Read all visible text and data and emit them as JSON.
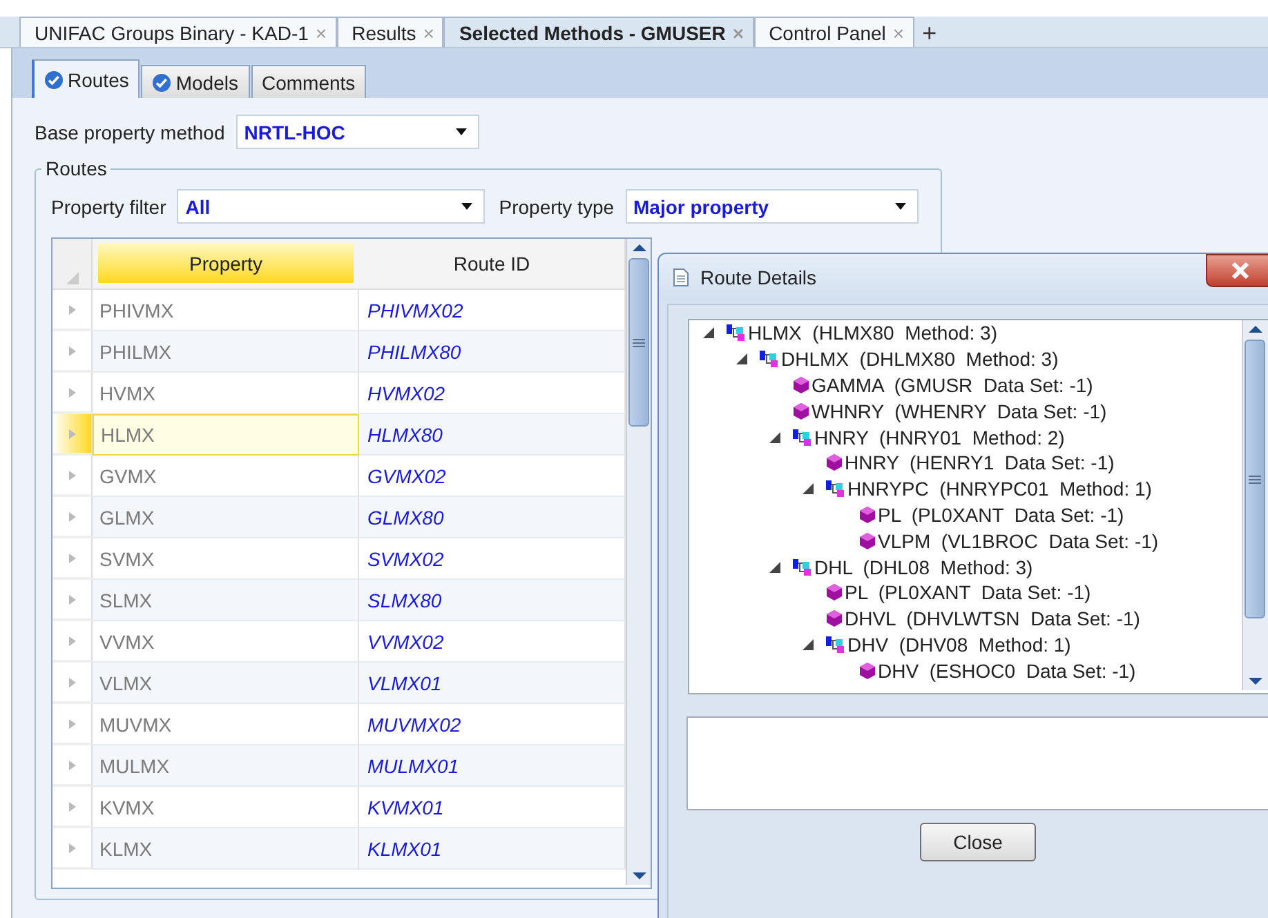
{
  "document_tabs": [
    {
      "label": "UNIFAC Groups Binary - KAD-1",
      "close": "×",
      "selected": false
    },
    {
      "label": "Results",
      "close": "×",
      "selected": false
    },
    {
      "label": "Selected Methods - GMUSER",
      "close": "×",
      "selected": true
    },
    {
      "label": "Control Panel",
      "close": "×",
      "selected": false
    }
  ],
  "new_tab": "+",
  "page_tabs": [
    {
      "label": "Routes",
      "selected": true,
      "checked": true
    },
    {
      "label": "Models",
      "selected": false,
      "checked": true
    },
    {
      "label": "Comments",
      "selected": false,
      "checked": false
    }
  ],
  "base_property_method": {
    "label": "Base property method",
    "value": "NRTL-HOC"
  },
  "routes": {
    "title": "Routes",
    "property_filter": {
      "label": "Property filter",
      "value": "All"
    },
    "property_type": {
      "label": "Property type",
      "value": "Major property"
    },
    "table": {
      "columns": [
        {
          "label": "Property",
          "selected": true
        },
        {
          "label": "Route ID",
          "selected": false
        }
      ],
      "rows": [
        {
          "property": "PHIVMX",
          "route_id": "PHIVMX02",
          "selected": false
        },
        {
          "property": "PHILMX",
          "route_id": "PHILMX80",
          "selected": false
        },
        {
          "property": "HVMX",
          "route_id": "HVMX02",
          "selected": false
        },
        {
          "property": "HLMX",
          "route_id": "HLMX80",
          "selected": true
        },
        {
          "property": "GVMX",
          "route_id": "GVMX02",
          "selected": false
        },
        {
          "property": "GLMX",
          "route_id": "GLMX80",
          "selected": false
        },
        {
          "property": "SVMX",
          "route_id": "SVMX02",
          "selected": false
        },
        {
          "property": "SLMX",
          "route_id": "SLMX80",
          "selected": false
        },
        {
          "property": "VVMX",
          "route_id": "VVMX02",
          "selected": false
        },
        {
          "property": "VLMX",
          "route_id": "VLMX01",
          "selected": false
        },
        {
          "property": "MUVMX",
          "route_id": "MUVMX02",
          "selected": false
        },
        {
          "property": "MULMX",
          "route_id": "MULMX01",
          "selected": false
        },
        {
          "property": "KVMX",
          "route_id": "KVMX01",
          "selected": false
        },
        {
          "property": "KLMX",
          "route_id": "KLMX01",
          "selected": false
        }
      ]
    }
  },
  "dialog": {
    "title": "Route Details",
    "button": "Close",
    "tree": [
      {
        "kind": "method",
        "label": "HLMX  (HLMX80  Method: 3)",
        "expanded": true,
        "children": [
          {
            "kind": "method",
            "label": "DHLMX  (DHLMX80  Method: 3)",
            "expanded": true,
            "children": [
              {
                "kind": "data",
                "label": "GAMMA  (GMUSR  Data Set: -1)"
              },
              {
                "kind": "data",
                "label": "WHNRY  (WHENRY  Data Set: -1)"
              },
              {
                "kind": "method",
                "label": "HNRY  (HNRY01  Method: 2)",
                "expanded": true,
                "children": [
                  {
                    "kind": "data",
                    "label": "HNRY  (HENRY1  Data Set: -1)"
                  },
                  {
                    "kind": "method",
                    "label": "HNRYPC  (HNRYPC01  Method: 1)",
                    "expanded": true,
                    "children": [
                      {
                        "kind": "data",
                        "label": "PL  (PL0XANT  Data Set: -1)"
                      },
                      {
                        "kind": "data",
                        "label": "VLPM  (VL1BROC  Data Set: -1)"
                      }
                    ]
                  }
                ]
              },
              {
                "kind": "method",
                "label": "DHL  (DHL08  Method: 3)",
                "expanded": true,
                "children": [
                  {
                    "kind": "data",
                    "label": "PL  (PL0XANT  Data Set: -1)"
                  },
                  {
                    "kind": "data",
                    "label": "DHVL  (DHVLWTSN  Data Set: -1)"
                  },
                  {
                    "kind": "method",
                    "label": "DHV  (DHV08  Method: 1)",
                    "expanded": true,
                    "children": [
                      {
                        "kind": "data",
                        "label": "DHV  (ESHOC0  Data Set: -1)"
                      }
                    ]
                  }
                ]
              }
            ]
          }
        ]
      }
    ]
  }
}
